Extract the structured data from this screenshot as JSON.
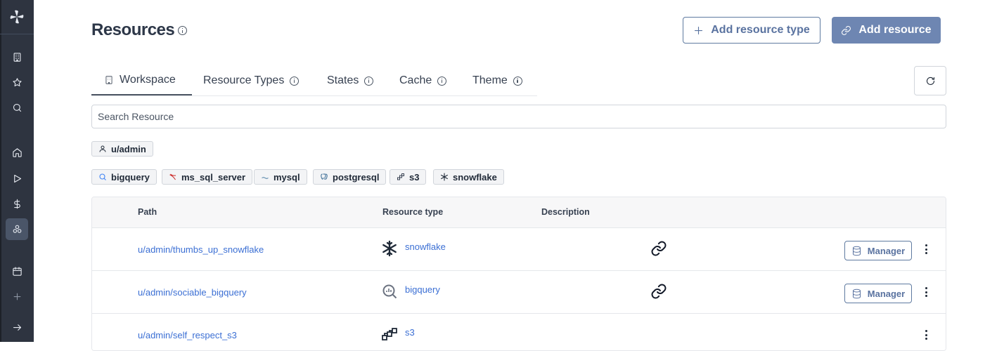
{
  "page": {
    "title": "Resources",
    "add_resource_type_label": "Add resource type",
    "add_resource_label": "Add resource"
  },
  "sidebar": {
    "items": [
      {
        "name": "workspace-icon"
      },
      {
        "name": "star-icon"
      },
      {
        "name": "search-icon"
      },
      {
        "name": "home-icon"
      },
      {
        "name": "play-icon"
      },
      {
        "name": "dollar-icon"
      },
      {
        "name": "resources-icon",
        "active": true
      },
      {
        "name": "calendar-icon"
      },
      {
        "name": "plus-icon"
      },
      {
        "name": "expand-arrow-icon"
      }
    ]
  },
  "tabs": [
    {
      "label": "Workspace",
      "active": true
    },
    {
      "label": "Resource Types"
    },
    {
      "label": "States"
    },
    {
      "label": "Cache"
    },
    {
      "label": "Theme"
    }
  ],
  "search": {
    "placeholder": "Search Resource"
  },
  "owner_filter": {
    "label": "u/admin"
  },
  "type_filters": [
    {
      "label": "bigquery"
    },
    {
      "label": "ms_sql_server"
    },
    {
      "label": "mysql"
    },
    {
      "label": "postgresql"
    },
    {
      "label": "s3"
    },
    {
      "label": "snowflake"
    }
  ],
  "table": {
    "headers": {
      "path": "Path",
      "resource_type": "Resource type",
      "description": "Description"
    },
    "rows": [
      {
        "path": "u/admin/thumbs_up_snowflake",
        "type": "snowflake",
        "manager_label": "Manager",
        "has_link": true,
        "has_manager": true
      },
      {
        "path": "u/admin/sociable_bigquery",
        "type": "bigquery",
        "manager_label": "Manager",
        "has_link": true,
        "has_manager": true
      },
      {
        "path": "u/admin/self_respect_s3",
        "type": "s3",
        "has_link": false,
        "has_manager": false
      }
    ]
  },
  "colors": {
    "sidebar": "#2e3440",
    "accent": "#6e86b2",
    "link": "#3b6fd4"
  }
}
